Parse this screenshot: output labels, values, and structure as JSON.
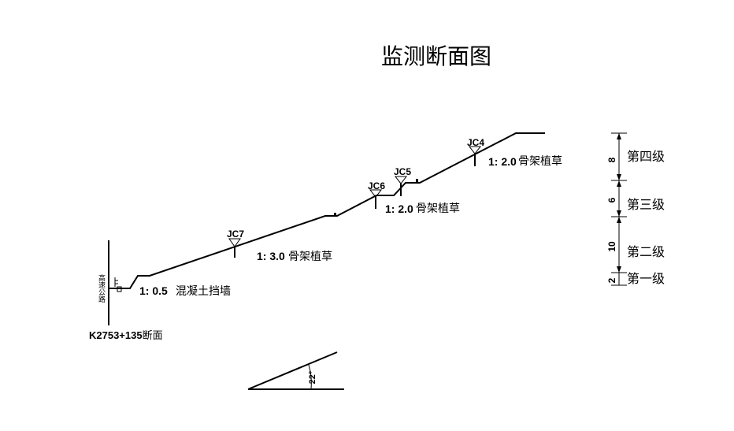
{
  "title": "监测断面图",
  "station": {
    "code": "K2753+135",
    "suffix": "断面"
  },
  "road_label": "高速公路",
  "slopes": [
    {
      "ratio": "1: 0.5",
      "note": "混凝土挡墙"
    },
    {
      "ratio": "1: 3.0",
      "note": "骨架植草"
    },
    {
      "ratio": "1: 2.0",
      "note": "骨架植草"
    },
    {
      "ratio": "1: 2.0",
      "note": "骨架植草"
    }
  ],
  "monitors": [
    "JC7",
    "JC6",
    "JC5",
    "JC4"
  ],
  "levels": [
    {
      "name": "第四级",
      "height": "8"
    },
    {
      "name": "第三级",
      "height": "6"
    },
    {
      "name": "第二级",
      "height": "10"
    },
    {
      "name": "第一级",
      "height": "2"
    }
  ],
  "angle": "22°"
}
